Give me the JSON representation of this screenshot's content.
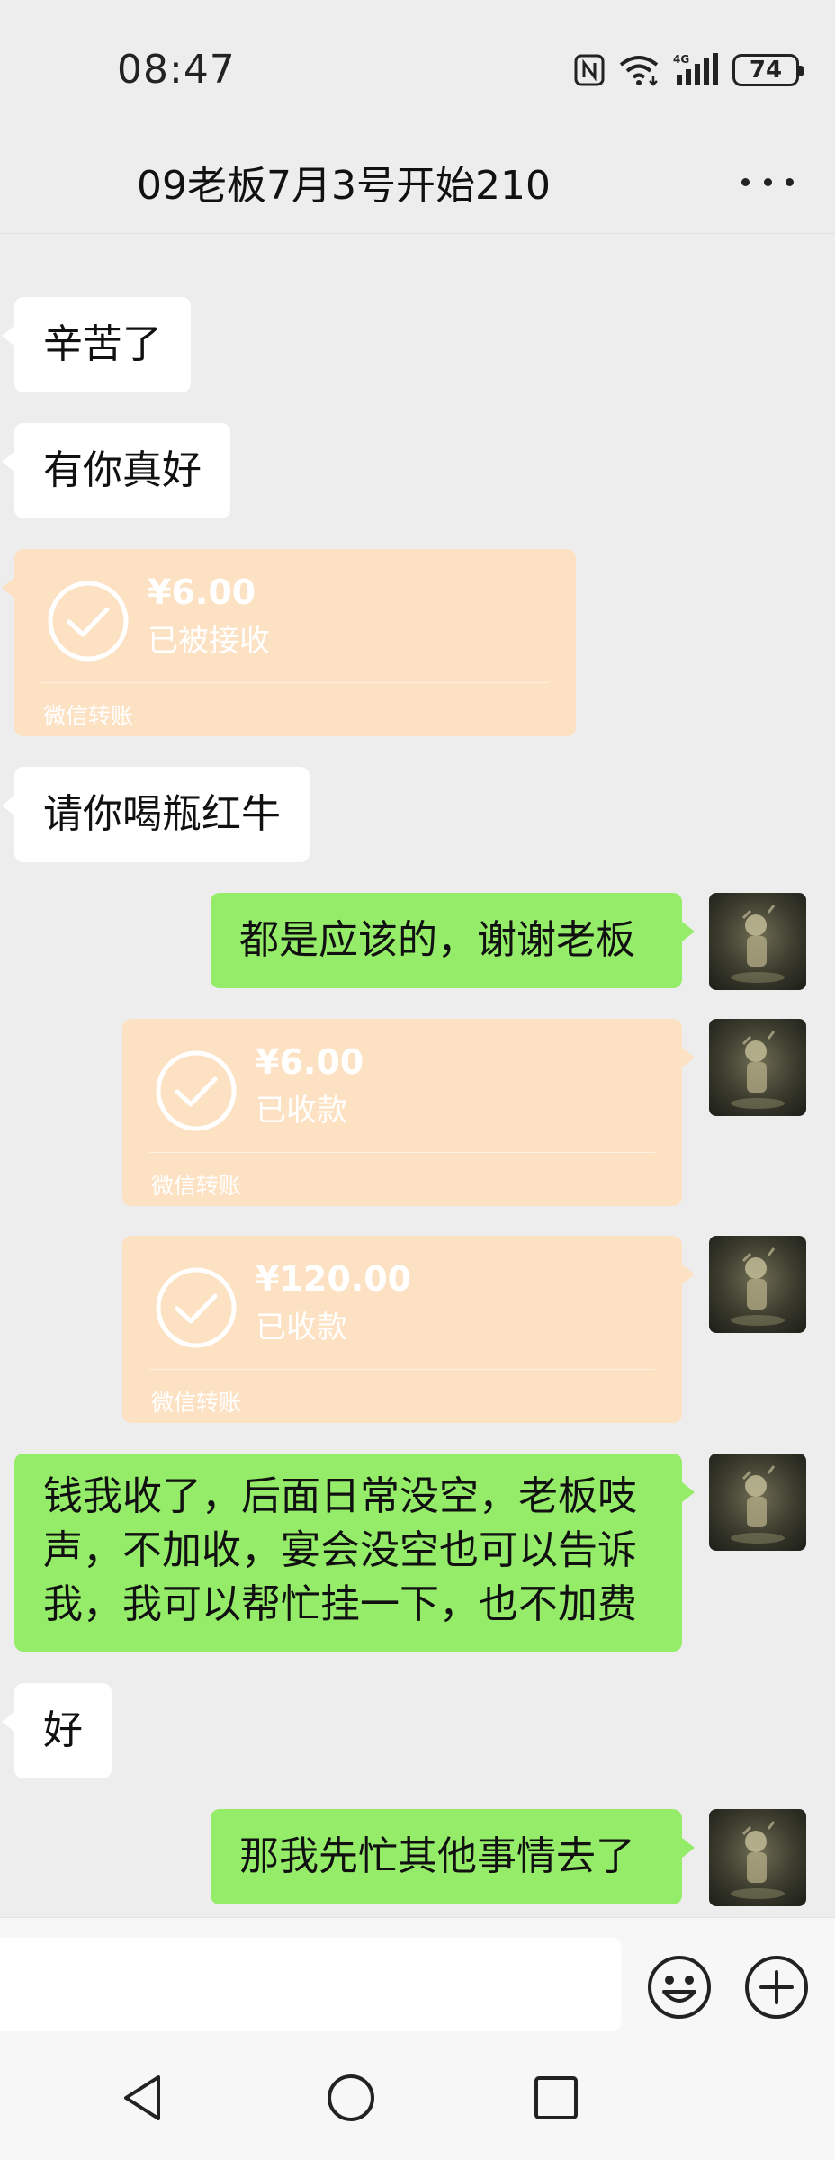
{
  "status_bar": {
    "time": "08:47",
    "battery": "74",
    "network": "4G"
  },
  "header": {
    "title": "09老板7月3号开始210"
  },
  "messages": [
    {
      "side": "in",
      "type": "text",
      "text": "辛苦了"
    },
    {
      "side": "in",
      "type": "text",
      "text": "有你真好"
    },
    {
      "side": "in",
      "type": "transfer",
      "amount": "¥6.00",
      "status": "已被接收",
      "footer": "微信转账"
    },
    {
      "side": "in",
      "type": "text",
      "text": "请你喝瓶红牛"
    },
    {
      "side": "out",
      "type": "text",
      "text": "都是应该的，谢谢老板"
    },
    {
      "side": "out",
      "type": "transfer",
      "amount": "¥6.00",
      "status": "已收款",
      "footer": "微信转账"
    },
    {
      "side": "out",
      "type": "transfer",
      "amount": "¥120.00",
      "status": "已收款",
      "footer": "微信转账"
    },
    {
      "side": "out",
      "type": "text",
      "lines": [
        "钱我收了，后面日常没空，老板吱",
        "声，不加收，宴会没空也可以告诉",
        "我，我可以帮忙挂一下，也不加费"
      ]
    },
    {
      "side": "in",
      "type": "text",
      "text": "好"
    },
    {
      "side": "out",
      "type": "text",
      "text": "那我先忙其他事情去了"
    }
  ],
  "input": {
    "value": "",
    "placeholder": ""
  },
  "colors": {
    "background": "#ededed",
    "out_bubble": "#95ec69",
    "in_bubble": "#ffffff",
    "transfer_done": "#fde1c3"
  },
  "icons": [
    "nfc-icon",
    "wifi-icon",
    "signal-icon",
    "battery-icon",
    "more-icon",
    "check-circle-icon",
    "avatar-image",
    "emoji-icon",
    "plus-circle-icon",
    "nav-back-icon",
    "nav-home-icon",
    "nav-recent-icon"
  ]
}
